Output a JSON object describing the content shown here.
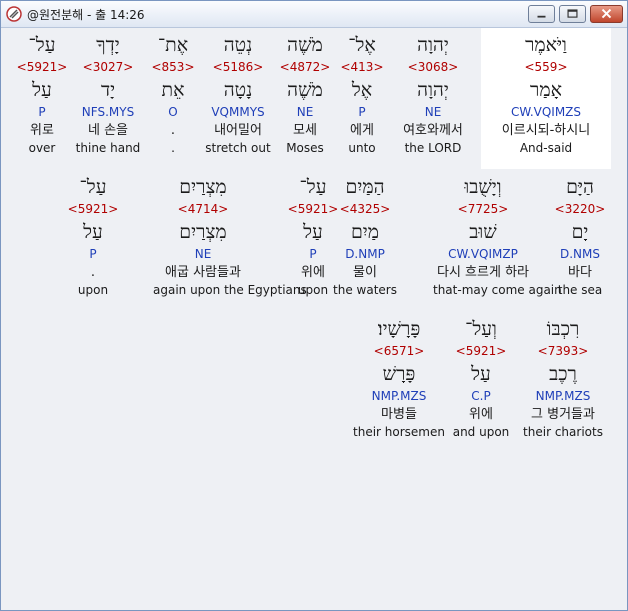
{
  "window": {
    "title": "@원전분해 - 출 14:26"
  },
  "rows": [
    {
      "words": [
        {
          "heb": "וַיֹּאמֶר",
          "strong": "<559>",
          "lemma": "אָמַר",
          "morph": "CW.VQIMZS",
          "kor": "이르시되-하시니",
          "eng": "And-said"
        },
        {
          "heb": "יְהוָה",
          "strong": "<3068>",
          "lemma": "יְהוָה",
          "morph": "NE",
          "kor": "여호와께서",
          "eng": "the LORD"
        },
        {
          "heb": "אֶל־",
          "strong": "<413>",
          "lemma": "אֶל",
          "morph": "P",
          "kor": "에게",
          "eng": "unto"
        },
        {
          "heb": "מֹשֶׁה",
          "strong": "<4872>",
          "lemma": "מֹשֶׁה",
          "morph": "NE",
          "kor": "모세",
          "eng": "Moses"
        },
        {
          "heb": "נְטֵה",
          "strong": "<5186>",
          "lemma": "נָטָה",
          "morph": "VQMMYS",
          "kor": "내어밀어",
          "eng": "stretch out"
        },
        {
          "heb": "אֶת־",
          "strong": "<853>",
          "lemma": "אֵת",
          "morph": "O",
          "kor": ".",
          "eng": "."
        },
        {
          "heb": "יָדְךָ",
          "strong": "<3027>",
          "lemma": "יָד",
          "morph": "NFS.MYS",
          "kor": "네 손을",
          "eng": "thine hand"
        },
        {
          "heb": "עַל־",
          "strong": "<5921>",
          "lemma": "עַל",
          "morph": "P",
          "kor": "위로",
          "eng": "over"
        }
      ]
    },
    {
      "words": [
        {
          "heb": "הַיָּם",
          "strong": "<3220>",
          "lemma": "יָם",
          "morph": "D.NMS",
          "kor": "바다",
          "eng": "the sea"
        },
        {
          "heb": "וְיָשֻׁבוּ",
          "strong": "<7725>",
          "lemma": "שׁוּב",
          "morph": "CW.VQIMZP",
          "kor": "다시 흐르게 하라",
          "eng": "that-may come again"
        },
        {
          "heb": "הַמַּיִם",
          "strong": "<4325>",
          "lemma": "מַיִם",
          "morph": "D.NMP",
          "kor": "물이",
          "eng": "the waters"
        },
        {
          "heb": "עַל־",
          "strong": "<5921>",
          "lemma": "עַל",
          "morph": "P",
          "kor": "위에",
          "eng": "upon"
        },
        {
          "heb": "מִצְרַיִם",
          "strong": "<4714>",
          "lemma": "מִצְרַיִם",
          "morph": "NE",
          "kor": "애굽 사람들과",
          "eng": "again upon the Egyptians"
        },
        {
          "heb": "עַל־",
          "strong": "<5921>",
          "lemma": "עַל",
          "morph": "P",
          "kor": ".",
          "eng": "upon"
        }
      ]
    },
    {
      "words": [
        {
          "heb": "רִכְבּוֹ",
          "strong": "<7393>",
          "lemma": "רֶכֶב",
          "morph": "NMP.MZS",
          "kor": "그 병거들과",
          "eng": "their chariots"
        },
        {
          "heb": "וְעַל־",
          "strong": "<5921>",
          "lemma": "עַל",
          "morph": "C.P",
          "kor": "위에",
          "eng": "and upon"
        },
        {
          "heb": "פָּרָשָׁיו׃",
          "strong": "<6571>",
          "lemma": "פָּרָשׁ",
          "morph": "NMP.MZS",
          "kor": "마병들",
          "eng": "their horsemen"
        }
      ]
    }
  ],
  "colors": {
    "strong": "#b00000",
    "morph": "#1f3fb8",
    "highlight": "#ffffff"
  }
}
